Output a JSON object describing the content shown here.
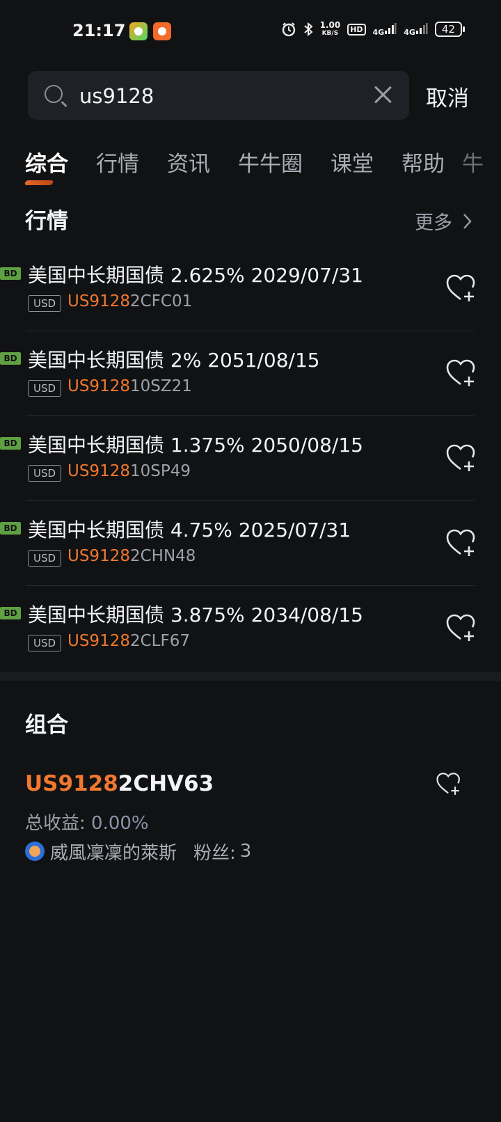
{
  "status_bar": {
    "time": "21:17",
    "net_speed_value": "1.00",
    "net_speed_unit": "KB/S",
    "hd_label": "HD",
    "signal1_label": "4G",
    "signal2_label": "4G",
    "battery": "42",
    "icons": [
      "alarm-icon",
      "bluetooth-icon",
      "hd-icon",
      "signal-icon",
      "signal-icon",
      "battery-icon"
    ]
  },
  "search": {
    "value": "us9128",
    "cancel_label": "取消"
  },
  "tabs": [
    {
      "label": "综合",
      "active": true
    },
    {
      "label": "行情",
      "active": false
    },
    {
      "label": "资讯",
      "active": false
    },
    {
      "label": "牛牛圈",
      "active": false
    },
    {
      "label": "课堂",
      "active": false
    },
    {
      "label": "帮助",
      "active": false
    },
    {
      "label": "牛",
      "active": false
    }
  ],
  "market_section": {
    "title": "行情",
    "more_label": "更多",
    "items": [
      {
        "badge": "BD",
        "name": "美国中长期国债 2.625% 2029/07/31",
        "currency": "USD",
        "code_highlight": "US9128",
        "code_rest": "2CFC01"
      },
      {
        "badge": "BD",
        "name": "美国中长期国债 2% 2051/08/15",
        "currency": "USD",
        "code_highlight": "US9128",
        "code_rest": "10SZ21"
      },
      {
        "badge": "BD",
        "name": "美国中长期国债 1.375% 2050/08/15",
        "currency": "USD",
        "code_highlight": "US9128",
        "code_rest": "10SP49"
      },
      {
        "badge": "BD",
        "name": "美国中长期国债 4.75% 2025/07/31",
        "currency": "USD",
        "code_highlight": "US9128",
        "code_rest": "2CHN48"
      },
      {
        "badge": "BD",
        "name": "美国中长期国债 3.875% 2034/08/15",
        "currency": "USD",
        "code_highlight": "US9128",
        "code_rest": "2CLF67"
      }
    ]
  },
  "portfolio_section": {
    "title": "组合",
    "code_highlight": "US9128",
    "code_rest": "2CHV63",
    "return_label": "总收益:",
    "return_value": "0.00%",
    "user_name": "威風凜凜的萊斯",
    "fans_label": "粉丝:",
    "fans_value": "3"
  },
  "colors": {
    "background": "#111214",
    "accent": "#f0782f",
    "badge": "#5fa043"
  }
}
